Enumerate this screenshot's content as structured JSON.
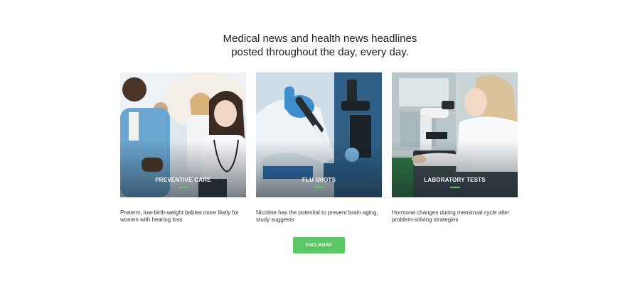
{
  "headline": {
    "line1": "Medical news and health news headlines",
    "line2": "posted throughout the day, every day."
  },
  "cards": [
    {
      "tag": "PREVENTIVE CARE",
      "text": "Preterm, low-birth-weight babies more likely for women with hearing loss"
    },
    {
      "tag": "FLU SHOTS",
      "text": "Nicotine has the potential to prevent brain aging, study suggests"
    },
    {
      "tag": "LABORATORY TESTS",
      "text": "Hormone changes during menstrual cycle alter problem-solving strategies"
    }
  ],
  "button": {
    "label": "FIND MORE"
  },
  "colors": {
    "accent": "#5dc767",
    "heading": "#1f1f1f",
    "body_text": "#333333"
  }
}
